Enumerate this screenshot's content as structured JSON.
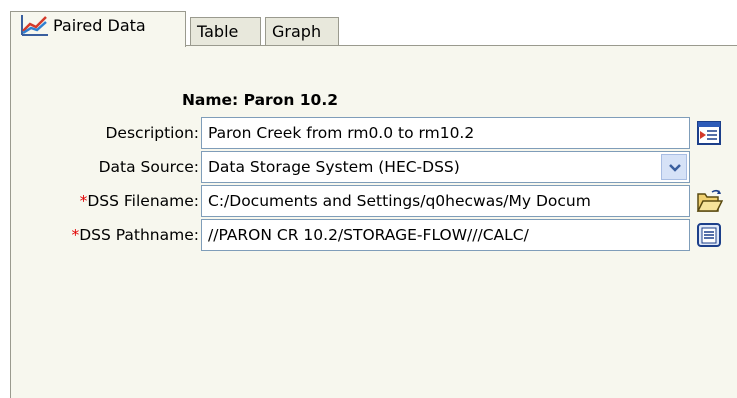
{
  "tabs": [
    {
      "label": "Paired Data",
      "active": true,
      "icon": "chart-line-icon"
    },
    {
      "label": "Table",
      "active": false
    },
    {
      "label": "Graph",
      "active": false
    }
  ],
  "form": {
    "name_label": "Name: Paron 10.2",
    "description_label": "Description:",
    "description_value": "Paron Creek from rm0.0 to rm10.2",
    "data_source_label": "Data Source:",
    "data_source_value": "Data Storage System (HEC-DSS)",
    "dss_filename_marker": "*",
    "dss_filename_label": "DSS Filename:",
    "dss_filename_value": "C:/Documents and Settings/q0hecwas/My Docum",
    "dss_pathname_marker": "*",
    "dss_pathname_label": "DSS Pathname:",
    "dss_pathname_value": "//PARON CR 10.2/STORAGE-FLOW///CALC/"
  },
  "icons": {
    "description_button": "edit-description-icon",
    "data_source_dropdown": "chevron-down-icon",
    "filename_button": "open-folder-icon",
    "pathname_button": "select-list-icon"
  },
  "colors": {
    "panel_bg": "#f7f7ee",
    "tab_bg": "#e8e8dc",
    "required_marker": "#e00000",
    "field_border": "#7f9db9",
    "dropdown_button": "#d6e2f7"
  }
}
